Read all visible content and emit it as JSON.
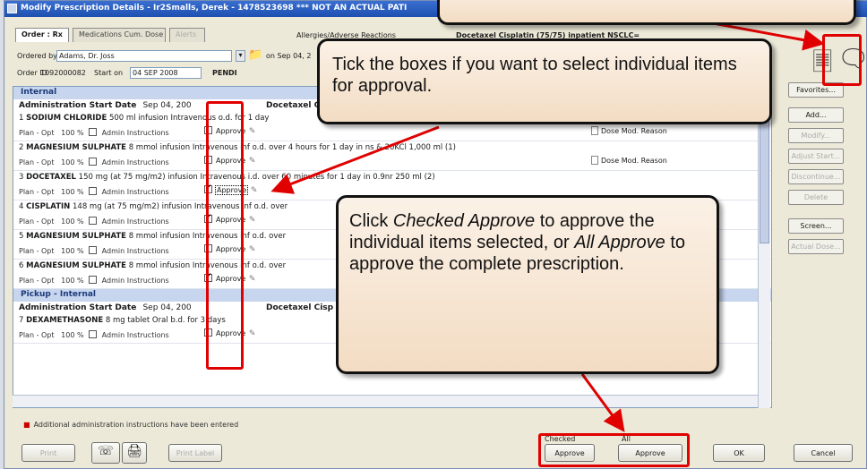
{
  "window": {
    "title": "Modify Prescription Details - Ir2Smalls, Derek - 1478523698 *** NOT AN ACTUAL PATI"
  },
  "tabs": [
    {
      "label": "Order : Rx",
      "active": true
    },
    {
      "label": "Medications Cum. Dose",
      "active": false
    },
    {
      "label": "Alerts",
      "active": false
    }
  ],
  "header": {
    "allergies_label": "Allergies/Adverse Reactions",
    "regimen": "Docetaxel Cisplatin (75/75) inpatient NSCLC=",
    "ordered_by_label": "Ordered by",
    "ordered_by_value": "Adams, Dr. Joss",
    "ordered_on": "on Sep 04, 2",
    "order_id_label": "Order ID",
    "order_id_value": "1092000082",
    "start_on_label": "Start on",
    "start_on_value": "04 SEP 2008",
    "status": "PENDI"
  },
  "list": {
    "section1": "Internal",
    "admin1_label": "Administration Start Date",
    "admin1_date": "Sep 04, 200",
    "admin1_regimen": "Docetaxel C",
    "section2": "Pickup - Internal",
    "admin2_label": "Administration Start Date",
    "admin2_date": "Sep 04, 200",
    "admin2_regimen": "Docetaxel Cisp",
    "plan_prefix": "Plan - Opt",
    "plan_pct": "100 %",
    "admin_instructions": "Admin Instructions",
    "approve": "Approve",
    "dose_mod": "Dose Mod. Reason",
    "items": [
      {
        "num": "1",
        "name": "SODIUM CHLORIDE",
        "detail": "500 ml infusion Intravenous o.d. for 1 day",
        "checked": false,
        "dose_mod": true
      },
      {
        "num": "2",
        "name": "MAGNESIUM SULPHATE",
        "detail": "8 mmol infusion Intravenous inf o.d. over 4 hours for 1 day in ns & 20KCl 1,000 ml (1)",
        "checked": false,
        "dose_mod": true
      },
      {
        "num": "3",
        "name": "DOCETAXEL",
        "detail": "150 mg (at 75 mg/m2) infusion Intravenous i.d. over 60 minutes for 1 day in 0.9nr 250 ml (2)",
        "checked": true,
        "dose_mod": false
      },
      {
        "num": "4",
        "name": "CISPLATIN",
        "detail": "148 mg (at 75 mg/m2) infusion Intravenous inf o.d. over",
        "checked": true,
        "dose_mod": false
      },
      {
        "num": "5",
        "name": "MAGNESIUM SULPHATE",
        "detail": "8 mmol infusion Intravenous inf o.d. over",
        "checked": false,
        "dose_mod": false
      },
      {
        "num": "6",
        "name": "MAGNESIUM SULPHATE",
        "detail": "8 mmol infusion Intravenous inf o.d. over",
        "checked": true,
        "dose_mod": false
      }
    ],
    "item7": {
      "num": "7",
      "name": "DEXAMETHASONE",
      "detail": "8 mg tablet Oral b.d. for 3 days",
      "checked": false
    }
  },
  "sidebar": {
    "favorites": "Favorites...",
    "add": "Add...",
    "modify": "Modify...",
    "adjust_start": "Adjust Start...",
    "discontinue": "Discontinue...",
    "delete": "Delete",
    "screen": "Screen...",
    "actual_dose": "Actual Dose..."
  },
  "footnote": "Additional administration instructions have been entered",
  "footer": {
    "print": "Print",
    "print_label": "Print Label",
    "checked_label": "Checked",
    "all_label": "All",
    "checked_approve": "Approve",
    "all_approve": "Approve",
    "ok": "OK",
    "cancel": "Cancel"
  },
  "callouts": {
    "tick": "Tick the boxes if you want to select individual items for approval.",
    "click_1": "Click ",
    "click_em1": "Checked Approve",
    "click_2": " to approve the individual items selected, or ",
    "click_em2": "All Approve",
    "click_3": " to approve the complete prescription."
  },
  "colors": {
    "annotation_red": "#e00000",
    "callout_fill": "#f6e4d0"
  }
}
